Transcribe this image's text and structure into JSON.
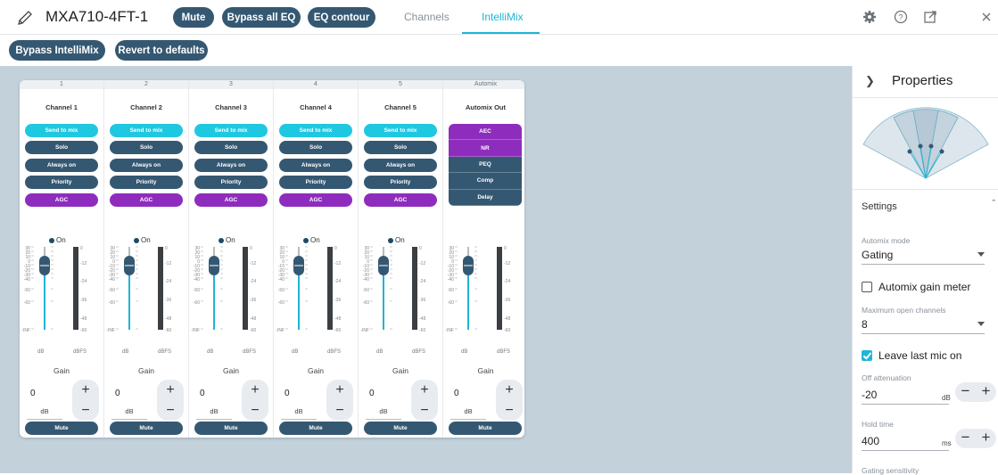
{
  "header": {
    "device_name": "MXA710-4FT-1",
    "mute_label": "Mute",
    "bypass_eq_label": "Bypass all EQ",
    "eq_contour_label": "EQ contour",
    "tabs": [
      {
        "label": "Channels"
      },
      {
        "label": "IntelliMix"
      }
    ],
    "active_tab": "IntelliMix"
  },
  "toolbar": {
    "bypass_intellimix_label": "Bypass IntelliMix",
    "revert_label": "Revert to defaults"
  },
  "channels": [
    {
      "num": "1",
      "name": "Channel 1",
      "send": "Send to mix",
      "solo": "Solo",
      "always": "Always on",
      "priority": "Priority",
      "agc": "AGC",
      "on": "On",
      "gain_label": "Gain",
      "gain": "0",
      "unit": "dB",
      "mute": "Mute"
    },
    {
      "num": "2",
      "name": "Channel 2",
      "send": "Send to mix",
      "solo": "Solo",
      "always": "Always on",
      "priority": "Priority",
      "agc": "AGC",
      "on": "On",
      "gain_label": "Gain",
      "gain": "0",
      "unit": "dB",
      "mute": "Mute"
    },
    {
      "num": "3",
      "name": "Channel 3",
      "send": "Send to mix",
      "solo": "Solo",
      "always": "Always on",
      "priority": "Priority",
      "agc": "AGC",
      "on": "On",
      "gain_label": "Gain",
      "gain": "0",
      "unit": "dB",
      "mute": "Mute"
    },
    {
      "num": "4",
      "name": "Channel 4",
      "send": "Send to mix",
      "solo": "Solo",
      "always": "Always on",
      "priority": "Priority",
      "agc": "AGC",
      "on": "On",
      "gain_label": "Gain",
      "gain": "0",
      "unit": "dB",
      "mute": "Mute"
    },
    {
      "num": "5",
      "name": "Channel 5",
      "send": "Send to mix",
      "solo": "Solo",
      "always": "Always on",
      "priority": "Priority",
      "agc": "AGC",
      "on": "On",
      "gain_label": "Gain",
      "gain": "0",
      "unit": "dB",
      "mute": "Mute"
    }
  ],
  "automix_out": {
    "num": "Automix",
    "name": "Automix Out",
    "aec": "AEC",
    "nr": "NR",
    "peq": "PEQ",
    "comp": "Comp",
    "delay": "Delay",
    "gain_label": "Gain",
    "gain": "0",
    "unit": "dB",
    "mute": "Mute"
  },
  "fader_scale": {
    "left": [
      "30",
      "20",
      "10",
      "0",
      "-10",
      "-20",
      "-30",
      "-40",
      "-50",
      "-60",
      "-INF"
    ],
    "right": [
      "0",
      "-12",
      "-24",
      "-36",
      "-48",
      "-60"
    ],
    "db": "dB",
    "dbfs": "dBFS"
  },
  "properties": {
    "title": "Properties",
    "settings_label": "Settings",
    "automix_mode_label": "Automix mode",
    "automix_mode": "Gating",
    "gain_meter_label": "Automix gain meter",
    "max_open_label": "Maximum open channels",
    "max_open": "8",
    "leave_last_label": "Leave last mic on",
    "off_atten_label": "Off attenuation",
    "off_atten": "-20",
    "off_atten_unit": "dB",
    "hold_label": "Hold time",
    "hold": "400",
    "hold_unit": "ms",
    "gating_label": "Gating sensitivity"
  },
  "colors": {
    "accent": "#1fb5d5",
    "navy": "#355872",
    "purple": "#8e2dbd",
    "cyan": "#1ec8e0",
    "stage": "#c3d1db"
  }
}
